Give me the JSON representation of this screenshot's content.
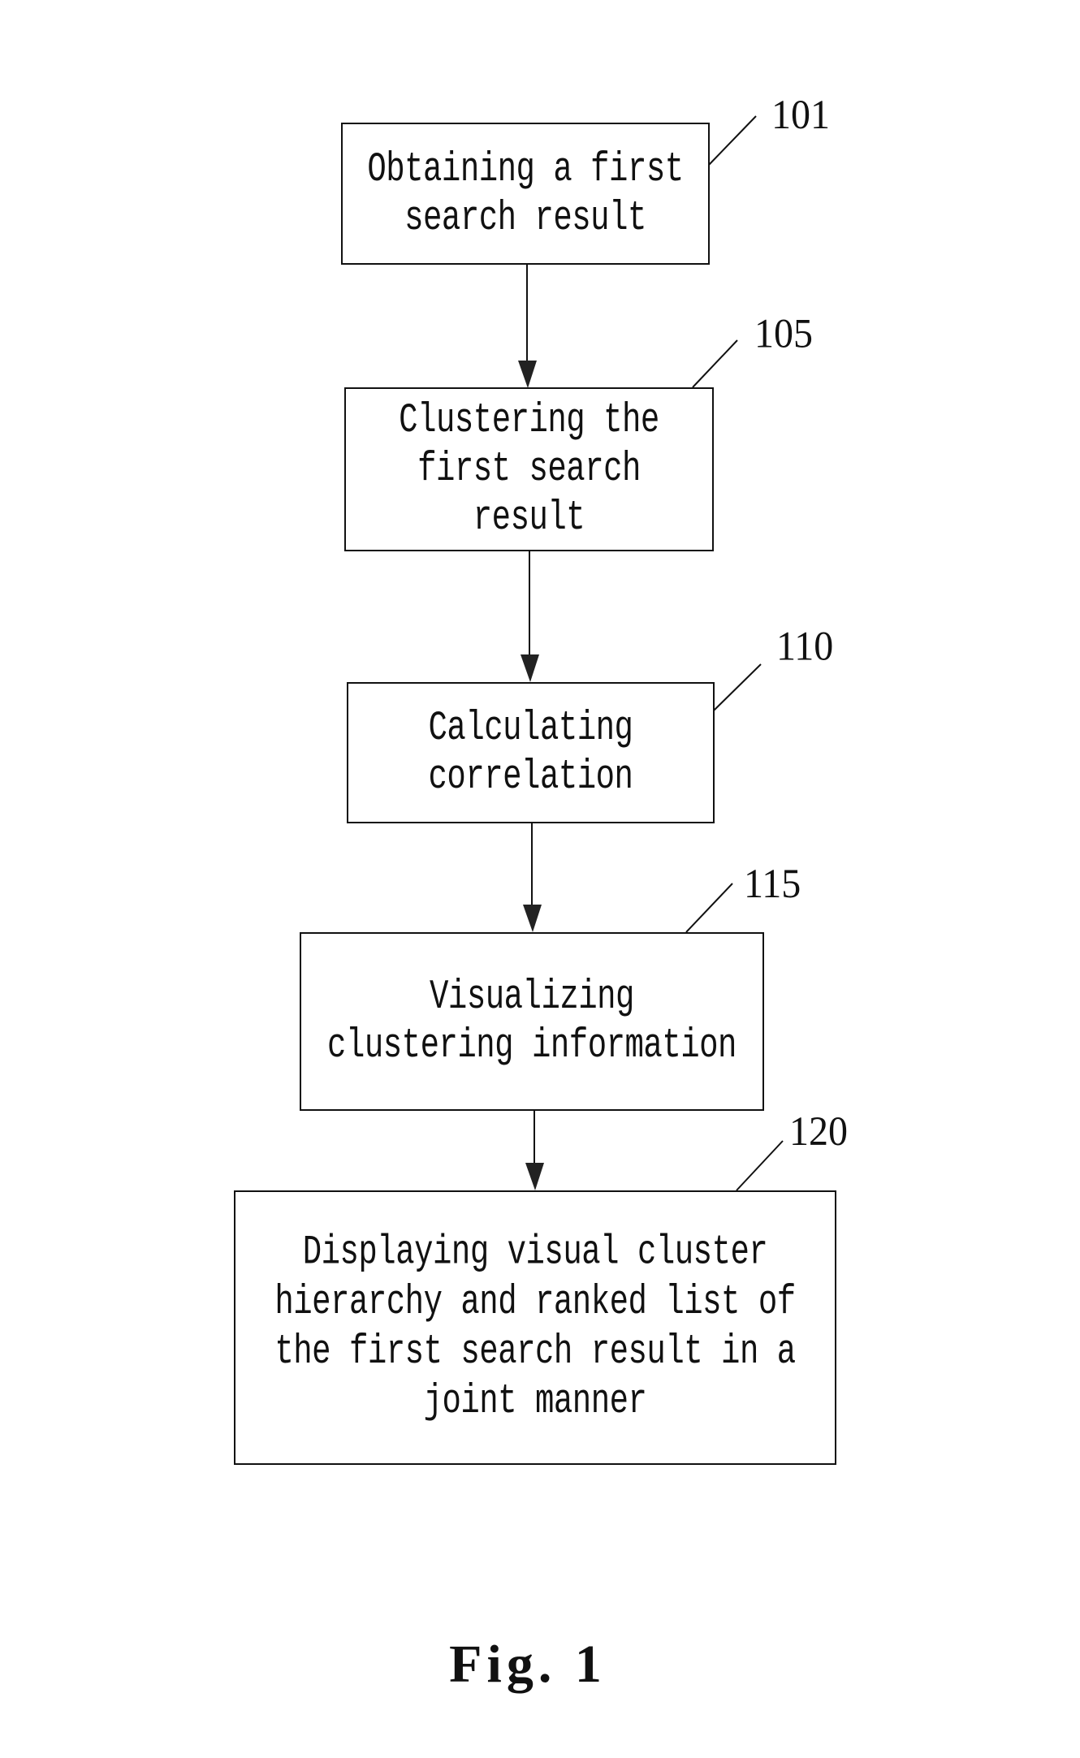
{
  "figure": {
    "caption": "Fig. 1",
    "steps": [
      {
        "ref": "101",
        "label": "Obtaining a first\nsearch result"
      },
      {
        "ref": "105",
        "label": "Clustering the\nfirst search\nresult"
      },
      {
        "ref": "110",
        "label": "Calculating\ncorrelation"
      },
      {
        "ref": "115",
        "label": "Visualizing\nclustering information"
      },
      {
        "ref": "120",
        "label": "Displaying visual cluster\nhierarchy and ranked list of\nthe first search result in a\njoint manner"
      }
    ],
    "flow": [
      {
        "from": "101",
        "to": "105"
      },
      {
        "from": "105",
        "to": "110"
      },
      {
        "from": "110",
        "to": "115"
      },
      {
        "from": "115",
        "to": "120"
      }
    ]
  }
}
